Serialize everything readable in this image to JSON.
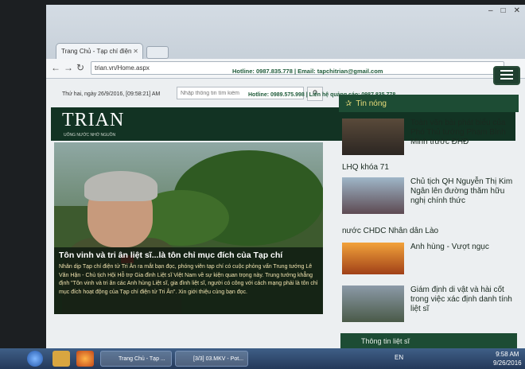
{
  "browser": {
    "tab_title": "Trang Chủ - Tạp chí điện",
    "url": "trian.vn/Home.aspx"
  },
  "site": {
    "contact": "Hotline: 0987.835.778 | Email: tapchitrian@gmail.com",
    "date": "Thứ hai, ngày 26/9/2016, [09:58:21] AM",
    "search_placeholder": "Nhập thông tin tìm kiếm",
    "hotline": "Hotline: 0989.575.998 | Liên hệ quảng cáo: 0987.835.778",
    "logo": "TRIAN",
    "logo_tagline": "UỐNG NƯỚC NHỚ NGUỒN"
  },
  "hero": {
    "title": "Tôn vinh và tri ân liệt sĩ...là tôn chỉ mục đích của Tạp chí",
    "body": "Nhân dịp Tạp chí điện tử Tri Ân ra mắt bạn đọc, phóng viên tạp chí có cuộc phỏng vấn Trung tướng Lê Văn Hận - Chủ tịch Hội Hỗ trợ Gia đình Liệt sĩ Việt Nam về sự kiện quan trọng này. Trung tướng khẳng định \"Tôn vinh và tri ân các Anh hùng Liệt sĩ, gia đình liệt sĩ, người có công với cách mạng phải là tôn chỉ mục đích hoạt động của Tạp chí điện tử Tri Ân\". Xin giới thiệu cùng bạn đọc."
  },
  "sidebar": {
    "heading": "Tin nóng",
    "news": [
      {
        "text": "Toàn văn bài phát biểu của Phó Thủ tướng Phạm Bình Minh trước ĐHĐ",
        "tail": "LHQ khóa 71"
      },
      {
        "text": "Chủ tịch QH Nguyễn Thị Kim Ngân lên đường thăm hữu nghị chính thức",
        "tail": "nước CHDC Nhân dân Lào"
      },
      {
        "text": "Anh hùng - Vượt ngục",
        "tail": ""
      },
      {
        "text": "Giám định di vật và hài cốt trong việc xác định danh tính liệt sĩ",
        "tail": ""
      }
    ],
    "footer": "Thông tin liệt sĩ"
  },
  "taskbar": {
    "task1": "Trang Chủ - Tạp ...",
    "task2": "[3/3] 03.MKV - Pot...",
    "lang": "EN",
    "time": "9:58 AM",
    "date": "9/26/2016"
  },
  "colors": {
    "header_green": "#123323",
    "accent_green": "#1d4c34",
    "hot_title": "#e9dc7a"
  }
}
